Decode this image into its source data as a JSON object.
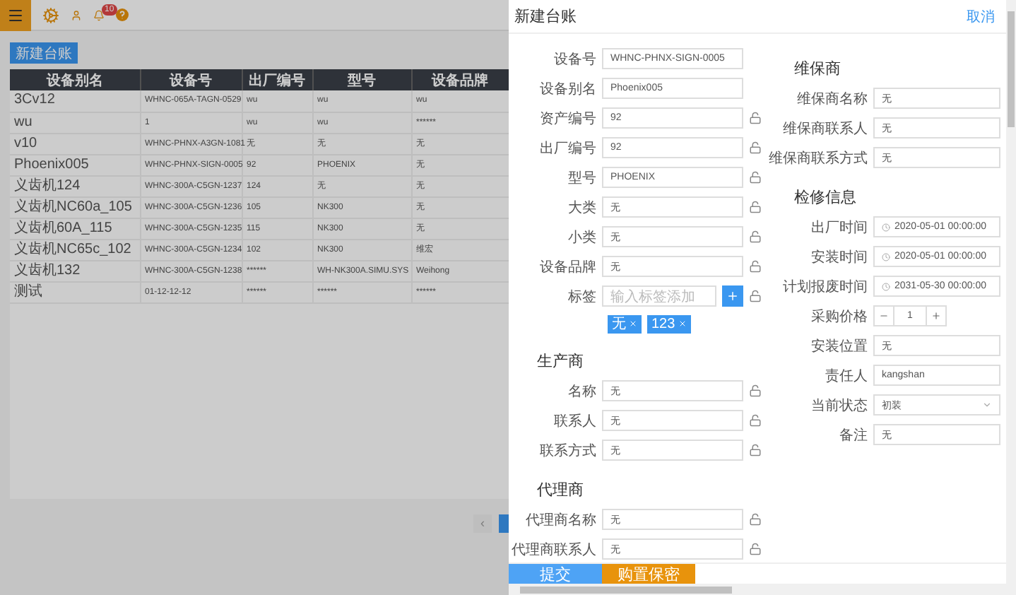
{
  "header": {
    "notification_count": "10"
  },
  "background": {
    "new_button": "新建台账",
    "table": {
      "columns": [
        "设备别名",
        "设备号",
        "出厂编号",
        "型号",
        "设备品牌"
      ],
      "rows": [
        [
          "3Cv12",
          "WHNC-065A-TAGN-0529",
          "wu",
          "wu",
          "wu"
        ],
        [
          "wu",
          "1",
          "wu",
          "wu",
          "******"
        ],
        [
          "v10",
          "WHNC-PHNX-A3GN-1081",
          "无",
          "无",
          "无"
        ],
        [
          "Phoenix005",
          "WHNC-PHNX-SIGN-0005",
          "92",
          "PHOENIX",
          "无"
        ],
        [
          "义齿机124",
          "WHNC-300A-C5GN-1237",
          "124",
          "无",
          "无"
        ],
        [
          "义齿机NC60a_105",
          "WHNC-300A-C5GN-1236",
          "105",
          "NK300",
          "无"
        ],
        [
          "义齿机60A_115",
          "WHNC-300A-C5GN-1235",
          "115",
          "NK300",
          "无"
        ],
        [
          "义齿机NC65c_102",
          "WHNC-300A-C5GN-1234",
          "102",
          "NK300",
          "维宏"
        ],
        [
          "义齿机132",
          "WHNC-300A-C5GN-1238",
          "******",
          "WH-NK300A.SIMU.SYS",
          "Weihong"
        ],
        [
          "测试",
          "01-12-12-12",
          "******",
          "******",
          "******"
        ]
      ]
    },
    "pagination": {
      "prev": "‹"
    }
  },
  "drawer": {
    "title": "新建台账",
    "cancel": "取消",
    "left": [
      {
        "kind": "field",
        "label": "设备号",
        "value": "WHNC-PHNX-SIGN-0005",
        "lock": false
      },
      {
        "kind": "field",
        "label": "设备别名",
        "value": "Phoenix005",
        "lock": false
      },
      {
        "kind": "field",
        "label": "资产编号",
        "value": "92",
        "lock": true
      },
      {
        "kind": "field",
        "label": "出厂编号",
        "value": "92",
        "lock": true
      },
      {
        "kind": "field",
        "label": "型号",
        "value": "PHOENIX",
        "lock": true
      },
      {
        "kind": "field",
        "label": "大类",
        "value": "无",
        "lock": true
      },
      {
        "kind": "field",
        "label": "小类",
        "value": "无",
        "lock": true
      },
      {
        "kind": "field",
        "label": "设备品牌",
        "value": "无",
        "lock": true
      },
      {
        "kind": "tags",
        "label": "标签",
        "placeholder": "输入标签添加",
        "tags": [
          "无",
          "123"
        ]
      },
      {
        "kind": "section",
        "title": "生产商"
      },
      {
        "kind": "field",
        "label": "名称",
        "value": "无",
        "lock": true
      },
      {
        "kind": "field",
        "label": "联系人",
        "value": "无",
        "lock": true
      },
      {
        "kind": "field",
        "label": "联系方式",
        "value": "无",
        "lock": true
      },
      {
        "kind": "section",
        "title": "代理商"
      },
      {
        "kind": "field",
        "label": "代理商名称",
        "value": "无",
        "lock": true
      },
      {
        "kind": "field",
        "label": "代理商联系人",
        "value": "无",
        "lock": true
      }
    ],
    "right": [
      {
        "kind": "section",
        "title": "维保商"
      },
      {
        "kind": "field",
        "label": "维保商名称",
        "value": "无"
      },
      {
        "kind": "field",
        "label": "维保商联系人",
        "value": "无"
      },
      {
        "kind": "field",
        "label": "维保商联系方式",
        "value": "无"
      },
      {
        "kind": "section",
        "title": "检修信息"
      },
      {
        "kind": "date",
        "label": "出厂时间",
        "value": "2020-05-01 00:00:00"
      },
      {
        "kind": "date",
        "label": "安装时间",
        "value": "2020-05-01 00:00:00"
      },
      {
        "kind": "date",
        "label": "计划报废时间",
        "value": "2031-05-30 00:00:00"
      },
      {
        "kind": "stepper",
        "label": "采购价格",
        "value": "1"
      },
      {
        "kind": "field",
        "label": "安装位置",
        "value": "无"
      },
      {
        "kind": "field",
        "label": "责任人",
        "value": "kangshan"
      },
      {
        "kind": "select",
        "label": "当前状态",
        "value": "初装"
      },
      {
        "kind": "field",
        "label": "备注",
        "value": "无"
      }
    ],
    "footer": [
      {
        "label": "提交",
        "kind": "primary"
      },
      {
        "label": "购置保密",
        "kind": "warning"
      }
    ]
  }
}
